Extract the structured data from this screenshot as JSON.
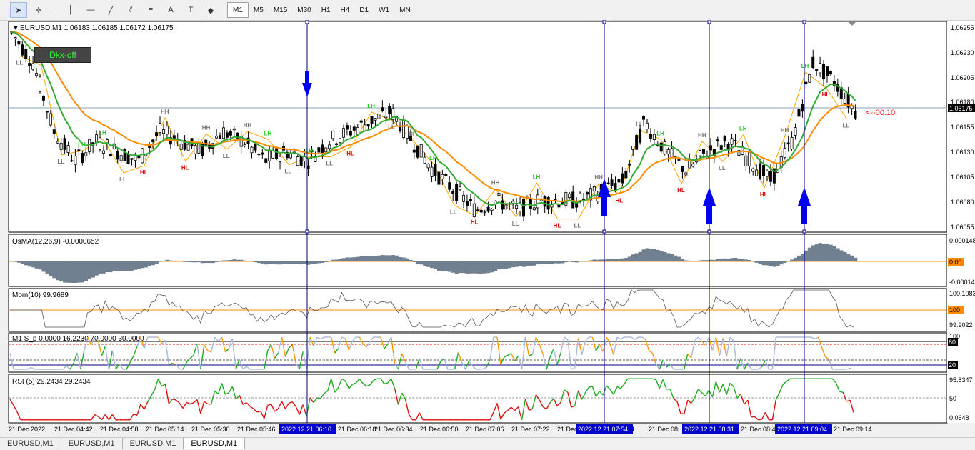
{
  "toolbar": {
    "tools": [
      {
        "icon": "cursor-icon"
      },
      {
        "icon": "crosshair-icon"
      },
      {
        "icon": "vertical-line-icon"
      },
      {
        "icon": "horizontal-line-icon"
      },
      {
        "icon": "trendline-icon"
      },
      {
        "icon": "channel-icon"
      },
      {
        "icon": "fibonacci-icon"
      },
      {
        "icon": "text-icon"
      },
      {
        "icon": "text-label-icon"
      },
      {
        "icon": "shapes-icon"
      }
    ],
    "timeframes": [
      "M1",
      "M5",
      "M15",
      "M30",
      "H1",
      "H4",
      "D1",
      "W1",
      "MN"
    ],
    "active_timeframe": "M1"
  },
  "main_chart": {
    "header": "EURUSD,M1  1.06183 1.06185 1.06172 1.06175",
    "dkx_button": "Dkx-off",
    "countdown": "<--00:10",
    "current_price": "1.06175",
    "price_ticks": [
      "1.06255",
      "1.06230",
      "1.06205",
      "1.06180",
      "1.06155",
      "1.06130",
      "1.06105",
      "1.06080",
      "1.06055"
    ],
    "swing_labels": [
      {
        "t": "LL",
        "c": "gray"
      },
      {
        "t": "LH",
        "c": "green"
      },
      {
        "t": "LL",
        "c": "gray"
      },
      {
        "t": "LH",
        "c": "green"
      },
      {
        "t": "LH",
        "c": "green"
      },
      {
        "t": "LL",
        "c": "gray"
      },
      {
        "t": "HL",
        "c": "red"
      },
      {
        "t": "HH",
        "c": "gray"
      },
      {
        "t": "HL",
        "c": "red"
      },
      {
        "t": "HH",
        "c": "gray"
      },
      {
        "t": "LL",
        "c": "gray"
      },
      {
        "t": "HH",
        "c": "gray"
      },
      {
        "t": "LH",
        "c": "green"
      },
      {
        "t": "LL",
        "c": "gray"
      },
      {
        "t": "LH",
        "c": "green"
      },
      {
        "t": "LL",
        "c": "gray"
      },
      {
        "t": "HL",
        "c": "red"
      },
      {
        "t": "LH",
        "c": "green"
      },
      {
        "t": "LL",
        "c": "gray"
      },
      {
        "t": "HH",
        "c": "gray"
      },
      {
        "t": "LH",
        "c": "green"
      },
      {
        "t": "LL",
        "c": "gray"
      },
      {
        "t": "HL",
        "c": "red"
      },
      {
        "t": "HH",
        "c": "gray"
      },
      {
        "t": "LL",
        "c": "gray"
      },
      {
        "t": "LH",
        "c": "green"
      },
      {
        "t": "HL",
        "c": "red"
      },
      {
        "t": "LL",
        "c": "gray"
      },
      {
        "t": "HH",
        "c": "gray"
      },
      {
        "t": "HL",
        "c": "red"
      },
      {
        "t": "HH",
        "c": "gray"
      },
      {
        "t": "LH",
        "c": "green"
      },
      {
        "t": "HL",
        "c": "red"
      },
      {
        "t": "HH",
        "c": "gray"
      },
      {
        "t": "LL",
        "c": "gray"
      },
      {
        "t": "LH",
        "c": "green"
      },
      {
        "t": "HL",
        "c": "red"
      },
      {
        "t": "HH",
        "c": "gray"
      },
      {
        "t": "LH",
        "c": "green"
      },
      {
        "t": "HL",
        "c": "red"
      },
      {
        "t": "LL",
        "c": "gray"
      }
    ]
  },
  "osma": {
    "header": "OsMA(12,26,9) -0.0000652",
    "ticks": [
      "0.000148",
      "0.00",
      "-0.00014"
    ],
    "level_label": "0.00"
  },
  "mom": {
    "header": "Mom(10) 99.9689",
    "ticks": [
      "100.1083",
      "100",
      "99.9022"
    ],
    "level_label": "100"
  },
  "stoch": {
    "header": "M1 S_p 0.0000 16.2230 70.0000 30.0000",
    "ticks": [
      "100",
      "80",
      "20"
    ]
  },
  "rsi": {
    "header": "RSI (5) 29.2434 29.2434",
    "ticks": [
      "95.8347",
      "50",
      "0.0648"
    ]
  },
  "time_axis": [
    "21 Dec 2022",
    "21 Dec 04:42",
    "21 Dec 04:58",
    "21 Dec 05:14",
    "21 Dec 05:30",
    "21 Dec 05:46",
    "21 Dec 06:18",
    "21 Dec 06:34",
    "21 Dec 06:50",
    "21 Dec 07:06",
    "21 Dec 07:22",
    "21 Dec",
    "54",
    "21 Dec 08:",
    "21 Dec 08:4",
    "21 Dec 09:14"
  ],
  "time_highlights": [
    "2022.12.21 06:10",
    "2022.12.21 07:54",
    "2022.12.21 08:31",
    "2022.12.21 09:04"
  ],
  "tabs": [
    "EURUSD,M1",
    "EURUSD,M1",
    "EURUSD,M1",
    "EURUSD,M1"
  ],
  "active_tab": 3,
  "colors": {
    "ma_fast": "#33aa33",
    "ma_slow": "#ff8c00",
    "marker": "#0000ee",
    "bull": "#1e7a1e",
    "bear": "#dd2020"
  },
  "chart_data": {
    "type": "line",
    "series": [
      {
        "values": [
          1.0625,
          1.0622,
          1.0615,
          1.0612,
          1.0614,
          1.0613,
          1.0612,
          1.0615,
          1.0614,
          1.0613,
          1.0615,
          1.0614,
          1.0612,
          1.0613,
          1.0612,
          1.0614,
          1.0615,
          1.0616,
          1.0617,
          1.0614,
          1.0611,
          1.0609,
          1.0607,
          1.0608,
          1.0607,
          1.0608,
          1.0608,
          1.0608,
          1.0609,
          1.061,
          1.0616,
          1.0613,
          1.0611,
          1.0613,
          1.0614,
          1.0612,
          1.061,
          1.0614,
          1.0622,
          1.062,
          1.0617
        ]
      }
    ],
    "ylim": [
      1.0605,
      1.0626
    ]
  }
}
